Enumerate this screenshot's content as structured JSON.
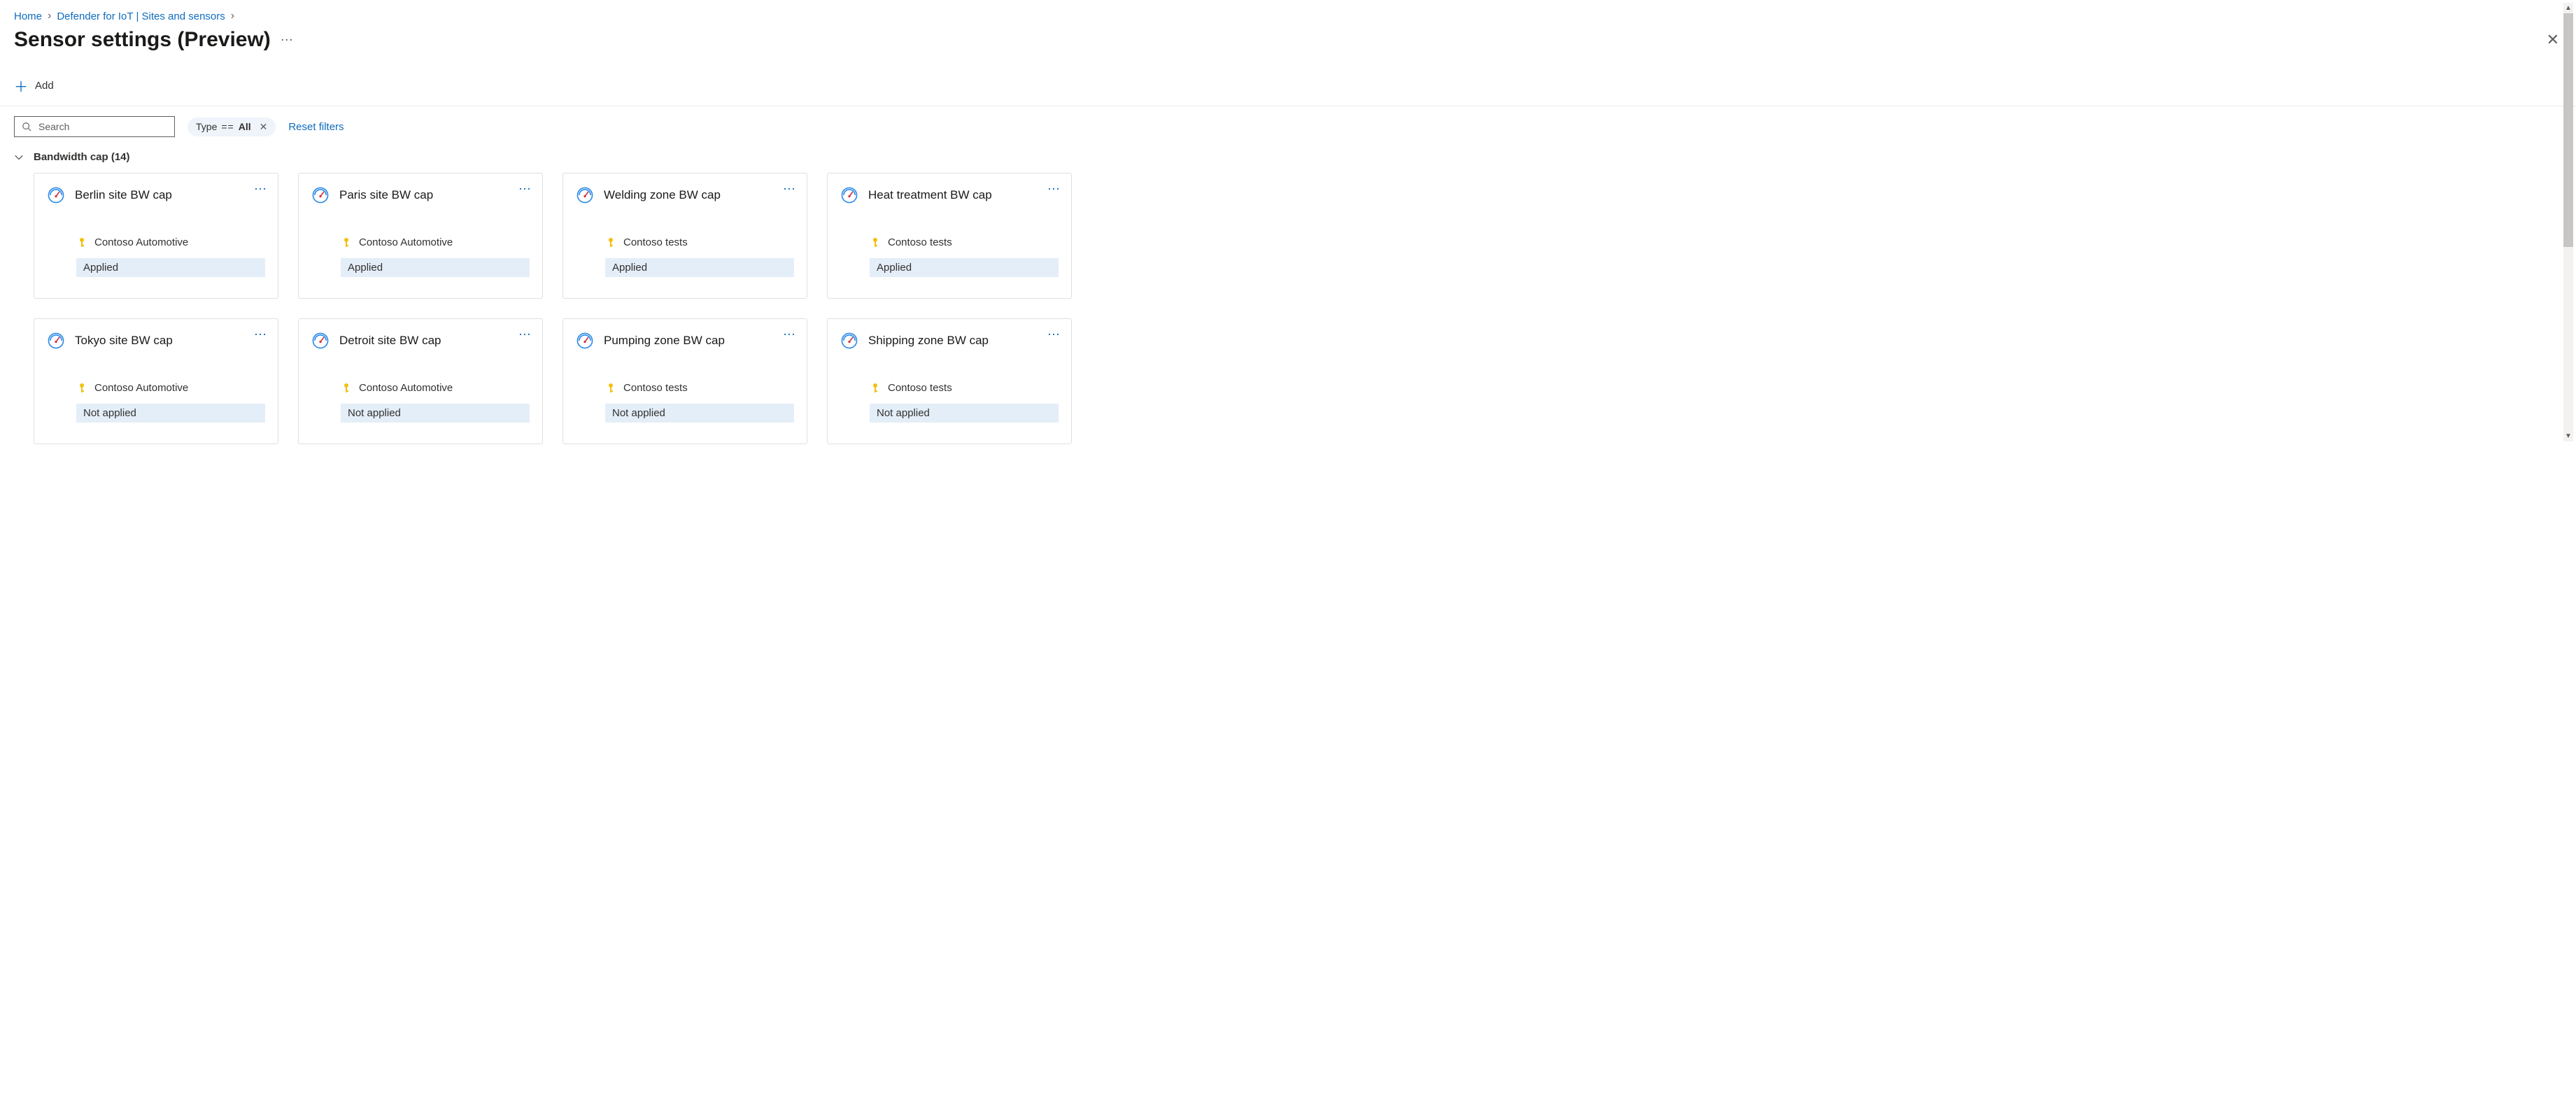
{
  "breadcrumb": {
    "items": [
      "Home",
      "Defender for IoT | Sites and sensors"
    ]
  },
  "page_title": "Sensor settings (Preview)",
  "toolbar": {
    "add_label": "Add"
  },
  "filter": {
    "search_placeholder": "Search",
    "pill_key": "Type",
    "pill_op": "==",
    "pill_value": "All",
    "reset_label": "Reset filters"
  },
  "section": {
    "title": "Bandwidth cap",
    "count": 14
  },
  "cards": [
    {
      "title": "Berlin site BW cap",
      "sub": "Contoso Automotive",
      "status": "Applied"
    },
    {
      "title": "Paris site BW cap",
      "sub": "Contoso Automotive",
      "status": "Applied"
    },
    {
      "title": "Welding zone BW cap",
      "sub": "Contoso tests",
      "status": "Applied"
    },
    {
      "title": "Heat treatment BW cap",
      "sub": "Contoso tests",
      "status": "Applied"
    },
    {
      "title": "Tokyo site BW cap",
      "sub": "Contoso Automotive",
      "status": "Not applied"
    },
    {
      "title": "Detroit site BW cap",
      "sub": "Contoso Automotive",
      "status": "Not applied"
    },
    {
      "title": "Pumping zone BW cap",
      "sub": "Contoso tests",
      "status": "Not applied"
    },
    {
      "title": "Shipping zone BW cap",
      "sub": "Contoso tests",
      "status": "Not applied"
    }
  ]
}
